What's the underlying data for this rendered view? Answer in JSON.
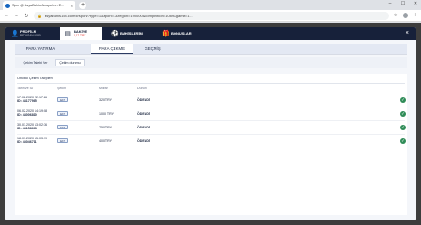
{
  "browser": {
    "tab_title": "Spor @ AsyaBahis Avrupa'nın E...",
    "tab_close": "×",
    "new_tab": "+",
    "url": "asyabahis154.com/#/sport/?type=1&sport=1&region=190000&competition=1089&game=1..."
  },
  "modal": {
    "close": "×",
    "header": {
      "profile": {
        "title": "PROFİLM",
        "sub": "BETASAN 8080"
      },
      "balance": {
        "title": "BAKİYE",
        "sub": "0,17 TRY"
      },
      "bets": {
        "title": "BAHİSLERİM"
      },
      "bonus": {
        "title": "BONUSLAR"
      }
    },
    "subtabs": [
      "PARA YATIRMA",
      "PARA ÇEKME",
      "GEÇMİŞ"
    ],
    "inner_tabs": [
      "Çekim Talebi Ver",
      "Çekim durumu"
    ],
    "section_title": "Önceki Çekim Talepleri",
    "columns": {
      "date": "Tarih ve ID",
      "type": "Şekim",
      "amount": "Miktar",
      "status": "Durum"
    },
    "rows": [
      {
        "date": "17.02.2020 22:17:26",
        "id": "ID: 44177985",
        "type": "EFT",
        "amount": "320 TRY",
        "status": "ÖDENDİ"
      },
      {
        "date": "06.02.2020 14:19:08",
        "id": "ID: 44006810",
        "type": "EFT",
        "amount": "1000 TRY",
        "status": "ÖDENDİ"
      },
      {
        "date": "30.01.2020 13:02:36",
        "id": "ID: 43158663",
        "type": "EFT",
        "amount": "750 TRY",
        "status": "ÖDENDİ"
      },
      {
        "date": "18.01.2020 15:03:19",
        "id": "ID: 43046711",
        "type": "EFT",
        "amount": "400 TRY",
        "status": "ÖDENDİ"
      }
    ]
  }
}
